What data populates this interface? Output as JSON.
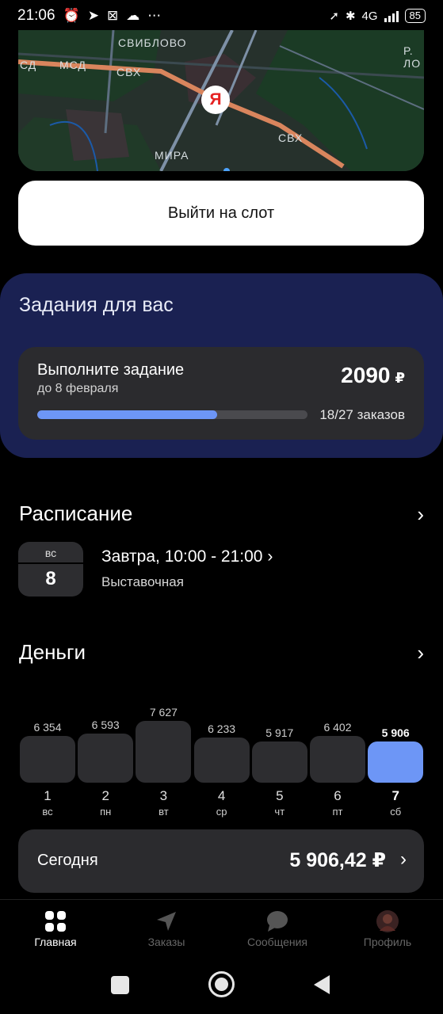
{
  "status_bar": {
    "time": "21:06",
    "network": "4G",
    "battery": "85"
  },
  "map": {
    "labels": [
      "СВИБЛОВО",
      "СД",
      "МСД",
      "СВХ",
      "СВХ",
      "МИРА",
      "Р. ЛО"
    ],
    "marker_letter": "Я"
  },
  "slot_button": {
    "label": "Выйти на слот"
  },
  "tasks": {
    "title": "Задания для вас",
    "card": {
      "name": "Выполните задание",
      "deadline": "до 8 февраля",
      "amount": "2090",
      "currency": "₽",
      "progress_text": "18/27 заказов",
      "progress_fraction": 0.667
    }
  },
  "schedule": {
    "title": "Расписание",
    "day_of_week": "вс",
    "day_number": "8",
    "time": "Завтра, 10:00 - 21:00",
    "place": "Выставочная"
  },
  "money": {
    "title": "Деньги",
    "today_label": "Сегодня",
    "today_amount": "5 906,42 ₽"
  },
  "chart_data": {
    "type": "bar",
    "categories": [
      "1",
      "2",
      "3",
      "4",
      "5",
      "6",
      "7"
    ],
    "day_abbr": [
      "вс",
      "пн",
      "вт",
      "ср",
      "чт",
      "пт",
      "сб"
    ],
    "labels": [
      "6 354",
      "6 593",
      "7 627",
      "6 233",
      "5 917",
      "6 402",
      "5 906"
    ],
    "values": [
      6354,
      6593,
      7627,
      6233,
      5917,
      6402,
      5906
    ],
    "active_index": 6,
    "colors": {
      "bar": "#2d2d30",
      "active": "#6d96f6"
    }
  },
  "bottom_nav": {
    "items": [
      {
        "label": "Главная",
        "icon": "grid-icon"
      },
      {
        "label": "Заказы",
        "icon": "navigation-arrow-icon"
      },
      {
        "label": "Сообщения",
        "icon": "chat-bubble-icon"
      },
      {
        "label": "Профиль",
        "icon": "avatar-icon"
      }
    ]
  },
  "colors": {
    "accent": "#6d96f6",
    "tasks_bg": "#1a2152",
    "card_bg": "#2b2b2e"
  }
}
